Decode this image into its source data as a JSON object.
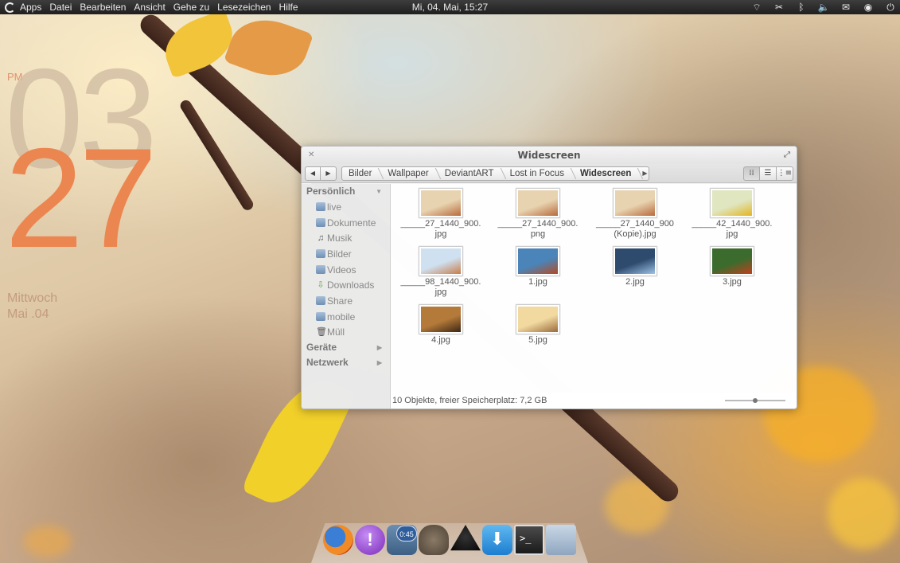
{
  "top_panel": {
    "menu": [
      "Apps",
      "Datei",
      "Bearbeiten",
      "Ansicht",
      "Gehe zu",
      "Lesezeichen",
      "Hilfe"
    ],
    "clock": "Mi, 04. Mai, 15:27",
    "tray_icons": [
      "wifi-icon",
      "scissors-icon",
      "bluetooth-icon",
      "volume-icon",
      "mail-icon",
      "gamepad-icon",
      "power-icon"
    ]
  },
  "desktop_clock": {
    "ampm": "PM",
    "hour": "03",
    "minute": "27",
    "weekday": "Mittwoch",
    "date": "Mai .04"
  },
  "window": {
    "title": "Widescreen",
    "breadcrumbs": [
      "Bilder",
      "Wallpaper",
      "DeviantART",
      "Lost in Focus",
      "Widescreen"
    ],
    "sidebar": {
      "personal_header": "Persönlich",
      "items": [
        "live",
        "Dokumente",
        "Musik",
        "Bilder",
        "Videos",
        "Downloads",
        "Share",
        "mobile",
        "Müll"
      ],
      "devices_header": "Geräte",
      "network_header": "Netzwerk"
    },
    "files": [
      {
        "name": "_____27_1440_900.\njpg",
        "colors": [
          "#e8d3b0",
          "#b86a3c"
        ]
      },
      {
        "name": "_____27_1440_900.\npng",
        "colors": [
          "#e8d3b0",
          "#b86a3c"
        ]
      },
      {
        "name": "_____27_1440_900\n(Kopie).jpg",
        "colors": [
          "#e8d3b0",
          "#b86a3c"
        ]
      },
      {
        "name": "_____42_1440_900.\njpg",
        "colors": [
          "#dfe6c0",
          "#e2b520"
        ]
      },
      {
        "name": "_____98_1440_900.\njpg",
        "colors": [
          "#cfe0f0",
          "#c77d4a"
        ]
      },
      {
        "name": "1.jpg",
        "colors": [
          "#4a84b8",
          "#b44a24"
        ]
      },
      {
        "name": "2.jpg",
        "colors": [
          "#2e4b6e",
          "#9fc3e6"
        ]
      },
      {
        "name": "3.jpg",
        "colors": [
          "#3c6b2e",
          "#c0401e"
        ]
      },
      {
        "name": "4.jpg",
        "colors": [
          "#b47a3a",
          "#3b2614"
        ]
      },
      {
        "name": "5.jpg",
        "colors": [
          "#f1d9a0",
          "#9a6a3a"
        ]
      }
    ],
    "status": "10 Objekte, freier Speicherplatz: 7,2 GB",
    "zoom_level": 0.5
  },
  "dock": {
    "icons": [
      "firefox-icon",
      "notification-icon",
      "timer-icon",
      "gimp-icon",
      "inkscape-icon",
      "download-icon",
      "terminal-icon",
      "folder-icon"
    ],
    "timer_badge": "0:45",
    "terminal_prompt": ">_",
    "alert_glyph": "!"
  }
}
